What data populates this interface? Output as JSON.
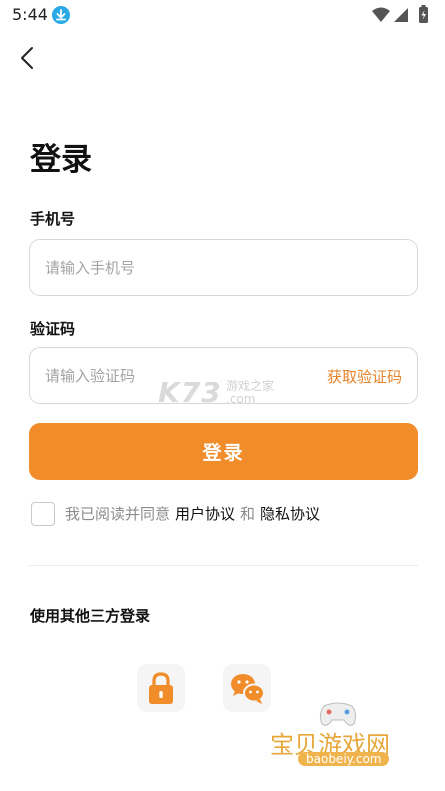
{
  "status_bar": {
    "time": "5:44"
  },
  "page": {
    "title": "登录"
  },
  "phone": {
    "label": "手机号",
    "placeholder": "请输入手机号",
    "value": ""
  },
  "code": {
    "label": "验证码",
    "placeholder": "请输入验证码",
    "value": "",
    "get_code_label": "获取验证码"
  },
  "login_button": {
    "label": "登录"
  },
  "agreement": {
    "prefix": "我已阅读并同意",
    "user_agreement": "用户协议",
    "conjunction": "和",
    "privacy_policy": "隐私协议",
    "checked": false
  },
  "third_party": {
    "title": "使用其他三方登录",
    "options": [
      "lock-icon",
      "wechat-icon"
    ]
  },
  "watermarks": {
    "k73_logo": "K73",
    "k73_sub_line1": "游戏之家",
    "k73_sub_line2": ".com",
    "bao_title": "宝贝游戏网",
    "bao_url": "baobeiy.com"
  },
  "colors": {
    "accent": "#f08c2a",
    "accent_text": "#e8832a",
    "download_badge": "#29a9e6",
    "wechat": "#f08c2a"
  }
}
